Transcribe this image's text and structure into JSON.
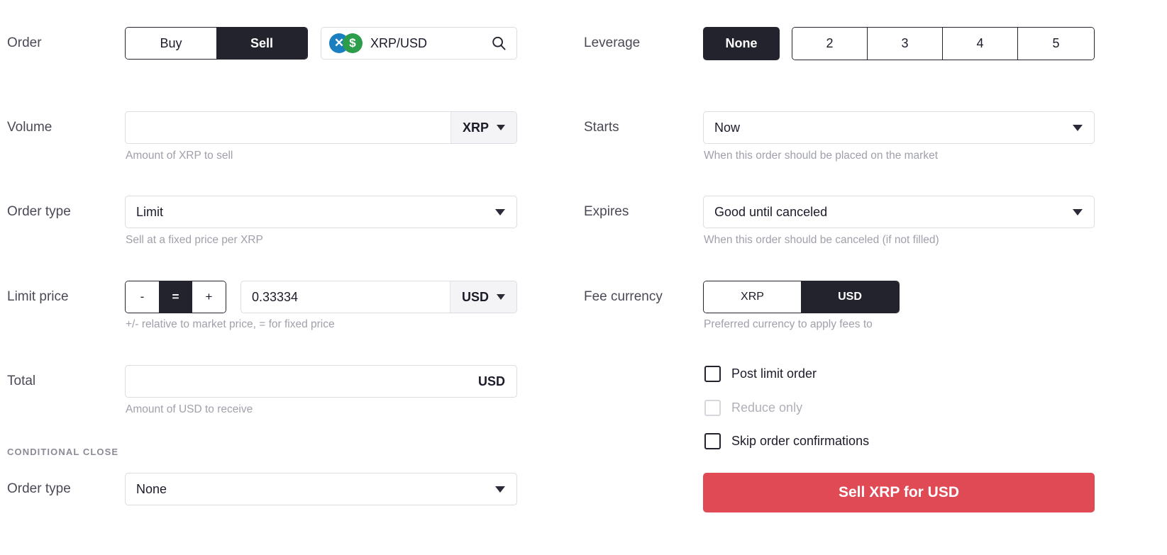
{
  "colors": {
    "dark": "#23232e",
    "sell_red": "#e04a55",
    "xrp_blue": "#1a7fc1",
    "usd_green": "#2c9e4b",
    "hint_gray": "#a0a0ab"
  },
  "order": {
    "label": "Order",
    "side_options": [
      "Buy",
      "Sell"
    ],
    "side_selected": "Sell",
    "pair": "XRP/USD",
    "base_icon": "xrp-coin-icon",
    "quote_icon": "usd-coin-icon",
    "search_icon": "search-icon"
  },
  "leverage": {
    "label": "Leverage",
    "none_label": "None",
    "options": [
      "2",
      "3",
      "4",
      "5"
    ],
    "selected": "None"
  },
  "volume": {
    "label": "Volume",
    "value": "",
    "placeholder": "",
    "unit": "XRP",
    "hint": "Amount of XRP to sell"
  },
  "starts": {
    "label": "Starts",
    "value": "Now",
    "hint": "When this order should be placed on the market"
  },
  "order_type": {
    "label": "Order type",
    "value": "Limit",
    "hint": "Sell at a fixed price per XRP"
  },
  "expires": {
    "label": "Expires",
    "value": "Good until canceled",
    "hint": "When this order should be canceled (if not filled)"
  },
  "limit_price": {
    "label": "Limit price",
    "stepper": [
      "-",
      "=",
      "+"
    ],
    "stepper_selected": "=",
    "value": "0.33334",
    "unit": "USD",
    "hint": "+/- relative to market price, = for fixed price"
  },
  "fee_currency": {
    "label": "Fee currency",
    "options": [
      "XRP",
      "USD"
    ],
    "selected": "USD",
    "hint": "Preferred currency to apply fees to"
  },
  "total": {
    "label": "Total",
    "value": "",
    "unit": "USD",
    "hint": "Amount of USD to receive"
  },
  "checkboxes": [
    {
      "label": "Post limit order",
      "checked": false,
      "disabled": false
    },
    {
      "label": "Reduce only",
      "checked": false,
      "disabled": true
    },
    {
      "label": "Skip order confirmations",
      "checked": false,
      "disabled": false
    }
  ],
  "conditional_close": {
    "title": "CONDITIONAL CLOSE",
    "order_type_label": "Order type",
    "order_type_value": "None"
  },
  "submit": {
    "label": "Sell XRP for USD"
  }
}
